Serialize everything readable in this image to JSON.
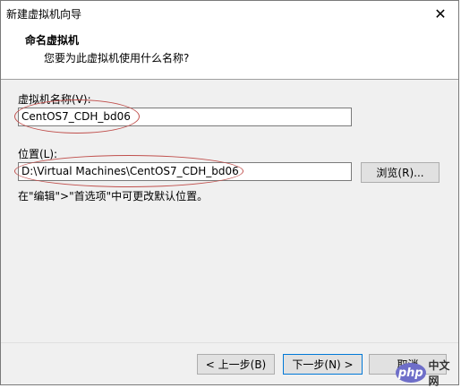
{
  "window": {
    "title": "新建虚拟机向导",
    "close_icon": "close-icon"
  },
  "header": {
    "title": "命名虚拟机",
    "subtitle": "您要为此虚拟机使用什么名称?"
  },
  "form": {
    "name_label": "虚拟机名称(V):",
    "name_value": "CentOS7_CDH_bd06",
    "location_label": "位置(L):",
    "location_value": "D:\\Virtual Machines\\CentOS7_CDH_bd06",
    "browse_label": "浏览(R)...",
    "hint": "在\"编辑\">\"首选项\"中可更改默认位置。"
  },
  "buttons": {
    "back": "< 上一步(B)",
    "next": "下一步(N) >",
    "cancel": "取消"
  },
  "watermark": {
    "brand": "php",
    "suffix": "中文网"
  },
  "colors": {
    "annotation_oval": "#c0504d",
    "default_button_border": "#0078d7"
  }
}
